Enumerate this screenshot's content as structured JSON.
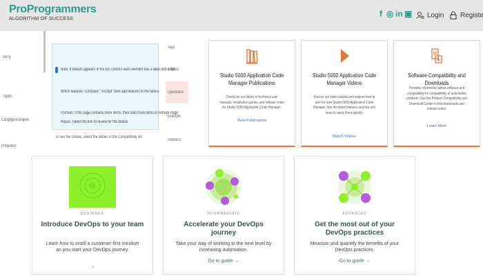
{
  "header": {
    "brand_name": "ProProgrammers",
    "brand_tagline": "ALGORITHM OF SUCCESS",
    "social": [
      "f",
      "◎",
      "in",
      "▣"
    ],
    "login_label": "Login",
    "register_label": "Register"
  },
  "left_nav": {
    "items": [
      "uniTy",
      "Topics",
      "Congfigure Engine",
      "Protection"
    ]
  },
  "doc_snippet": {
    "lines": [
      "Note: If feature appears in the list, confirm each element has a label and a title.",
      "Which features \"Compare\" \"Accept\" then add features to the tables.",
      "Formats: If the page contains more items, then load more items to remove Page.",
      "Repos: Select the link to review for the details."
    ],
    "footer": "To see the Details, select the details in the Compatibility list."
  },
  "mid_nav": {
    "items": [
      "Tags",
      "Objects",
      "Operations",
      "Example",
      "Statistics"
    ]
  },
  "top_cards": [
    {
      "title": "Studio 5000 Application Code Manager Publications",
      "desc": "Check out our library of technical user manuals, installation guides, and release notes for Studio 5000 Application Code Manager.",
      "link": "View Publications",
      "icon": "books-icon"
    },
    {
      "title": "Studio 5000 Application Code Manager Videos",
      "desc": "Access our video playlist and explore how to use the new Studio 5000 Application Code Manager. Get the latest features and tips and learn to apply them quickly.",
      "link": "Watch Videos",
      "icon": "play-icon"
    },
    {
      "title": "Software Compatibility and Downloads",
      "desc": "Provides information about software and compatibility for compatibility of automation products. Use the Product Compatibility and Download Center to find downloads and release notes.",
      "link": "Learn More",
      "icon": "download-icon"
    }
  ],
  "guide_cards": [
    {
      "level": "BEGINNER",
      "title": "Introduce DevOps to your team",
      "desc": "Learn how to instill a customer-first mindset as you start your DevOps journey.",
      "link": "→"
    },
    {
      "level": "INTERMEDIATE",
      "title": "Accelerate your DevOps journey",
      "desc": "Take your way of working to the next level by increasing automation.",
      "link": "Go to guide →"
    },
    {
      "level": "ADVANCED",
      "title": "Get the most out of your DevOps practices",
      "desc": "Measure and quantify the benefits of your DevOps practices.",
      "link": "Go to guide →"
    }
  ],
  "colors": {
    "brand": "#2a9d8f",
    "card_accent": "#e07a3a",
    "guide_title": "#2d5d43",
    "lime": "#8ef02a",
    "purple": "#b45be0"
  }
}
